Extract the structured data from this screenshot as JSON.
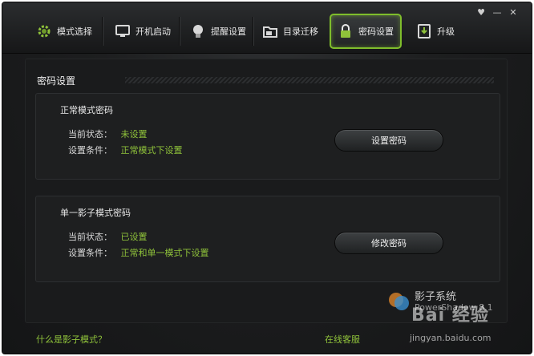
{
  "tabs": [
    {
      "label": "模式选择",
      "icon": "gear-icon"
    },
    {
      "label": "开机启动",
      "icon": "monitor-icon"
    },
    {
      "label": "提醒设置",
      "icon": "bulb-icon"
    },
    {
      "label": "目录迁移",
      "icon": "folder-icon"
    },
    {
      "label": "密码设置",
      "icon": "lock-icon",
      "active": true
    },
    {
      "label": "升级",
      "icon": "download-icon"
    }
  ],
  "window_controls": {
    "skin": "♥",
    "minimize": "—",
    "close": "✕"
  },
  "page": {
    "title": "密码设置"
  },
  "normal_password": {
    "title": "正常模式密码",
    "status_label": "当前状态：",
    "status_value": "未设置",
    "condition_label": "设置条件：",
    "condition_value": "正常模式下设置",
    "button": "设置密码"
  },
  "shadow_password": {
    "title": "单一影子模式密码",
    "status_label": "当前状态：",
    "status_value": "已设置",
    "condition_label": "设置条件：",
    "condition_value": "正常和单一模式下设置",
    "button": "修改密码"
  },
  "footer": {
    "help_link": "什么是影子模式？",
    "support_link": "在线客服"
  },
  "brand": {
    "name": "影子系统",
    "product": "PowerShadow 8.1"
  },
  "watermark": {
    "text": "Bai 经验",
    "url": "jingyan.baidu.com"
  },
  "colors": {
    "accent": "#8fc23a",
    "active_border": "#7fbd2c",
    "background": "#1a1b1c"
  }
}
